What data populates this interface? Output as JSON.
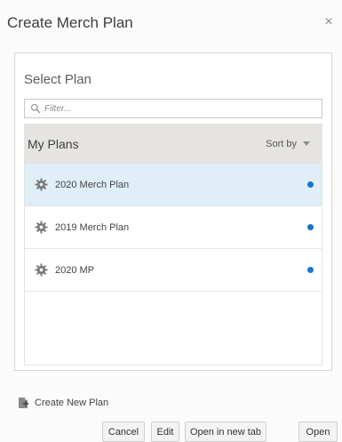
{
  "dialog": {
    "title": "Create Merch Plan",
    "close_icon": "×"
  },
  "panel": {
    "heading": "Select Plan",
    "filter_placeholder": "Filter...",
    "list_title": "My Plans",
    "sort_label": "Sort by",
    "plans": [
      {
        "label": "2020 Merch Plan",
        "selected": true
      },
      {
        "label": "2019 Merch Plan",
        "selected": false
      },
      {
        "label": "2020 MP",
        "selected": false
      }
    ]
  },
  "footer": {
    "create_new": "Create New Plan",
    "buttons": {
      "cancel": "Cancel",
      "edit": "Edit",
      "open_new_tab": "Open in new tab",
      "open": "Open"
    }
  },
  "icons": {
    "search": "search-icon",
    "gear": "gear-icon",
    "create_plan": "create-plan-icon",
    "close": "close-icon",
    "status_dot": "status-dot-icon"
  },
  "colors": {
    "selected_row": "#dfeef7",
    "header_bg": "#e6e4e0",
    "status_dot": "#1a73d1"
  }
}
